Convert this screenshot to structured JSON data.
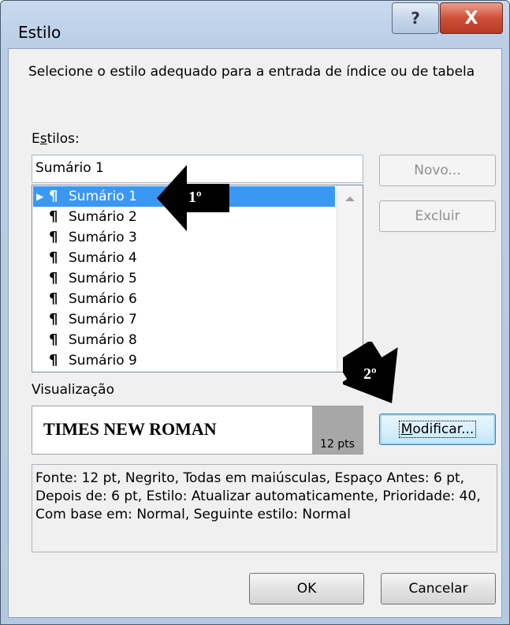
{
  "window": {
    "title": "Estilo",
    "help_glyph": "?",
    "close_glyph": "X"
  },
  "instruction": "Selecione o estilo adequado para a entrada de índice ou de tabela",
  "styles_label": {
    "pre": "E",
    "accel": "s",
    "post": "tilos:"
  },
  "style_input_value": "Sumário 1",
  "styles": [
    {
      "label": "Sumário 1",
      "selected": true
    },
    {
      "label": "Sumário 2",
      "selected": false
    },
    {
      "label": "Sumário 3",
      "selected": false
    },
    {
      "label": "Sumário 4",
      "selected": false
    },
    {
      "label": "Sumário 5",
      "selected": false
    },
    {
      "label": "Sumário 6",
      "selected": false
    },
    {
      "label": "Sumário 7",
      "selected": false
    },
    {
      "label": "Sumário 8",
      "selected": false
    },
    {
      "label": "Sumário 9",
      "selected": false
    }
  ],
  "paragraph_glyph": "¶",
  "selected_marker_glyph": "▶",
  "buttons": {
    "novo": "Novo...",
    "excluir": "Excluir",
    "modificar": {
      "accel": "M",
      "rest": "odificar..."
    },
    "ok": "OK",
    "cancelar": "Cancelar"
  },
  "preview": {
    "label": "Visualização",
    "sample_text": "TIMES NEW ROMAN",
    "size_text": "12 pts"
  },
  "description": "Fonte: 12 pt, Negrito, Todas em maiúsculas, Espaço Antes: 6 pt, Depois de: 6 pt, Estilo: Atualizar automaticamente, Prioridade: 40, Com base em: Normal, Seguinte estilo: Normal",
  "annotations": {
    "step1": "1º",
    "step2": "2º"
  },
  "colors": {
    "selection": "#3a98f5",
    "annotation_arrow": "#000000"
  }
}
